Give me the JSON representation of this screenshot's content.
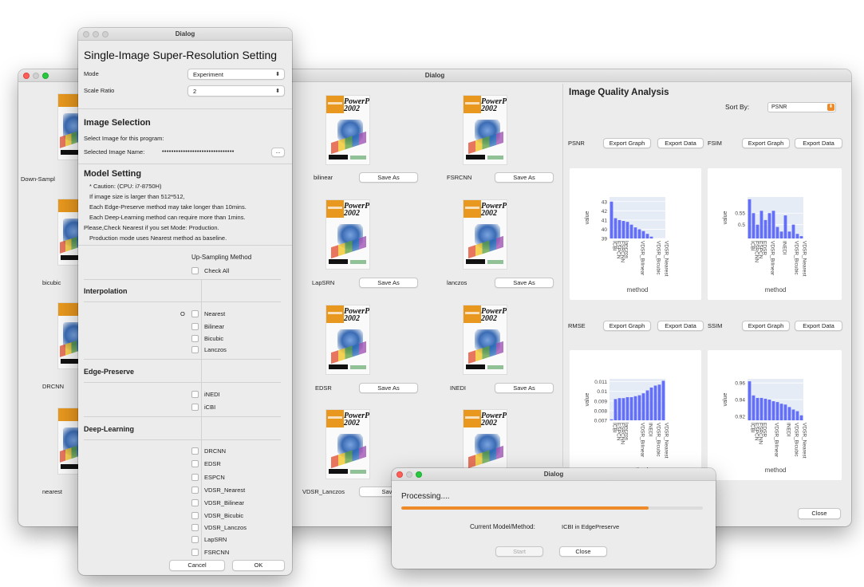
{
  "main_window": {
    "title": "Dialog",
    "left_column": [
      {
        "label": "Down-Sampl"
      },
      {
        "label": "bicubic"
      },
      {
        "label": "DRCNN"
      },
      {
        "label": "nearest"
      }
    ],
    "grid": [
      {
        "label": "bilinear",
        "button": "Save As"
      },
      {
        "label": "FSRCNN",
        "button": "Save As"
      },
      {
        "label": "LapSRN",
        "button": "Save As"
      },
      {
        "label": "lanczos",
        "button": "Save As"
      },
      {
        "label": "EDSR",
        "button": "Save As"
      },
      {
        "label": "INEDI",
        "button": "Save As"
      },
      {
        "label": "VDSR_Lanczos",
        "button": "Save"
      }
    ],
    "thumb_text": {
      "power": "PowerPoint",
      "year": "2002"
    },
    "analysis": {
      "title": "Image Quality Analysis",
      "sort_by_label": "Sort By:",
      "sort_by_value": "PSNR",
      "export_graph": "Export Graph",
      "export_data": "Export Data",
      "close": "Close",
      "bar_color": "#636efa",
      "metrics": [
        "PSNR",
        "FSIM",
        "RMSE",
        "SSIM"
      ]
    }
  },
  "chart_data": [
    {
      "type": "bar",
      "title": "PSNR",
      "xlabel": "method",
      "ylabel": "value",
      "categories": [
        "ICBI",
        "ESPCN",
        "FSRCNN",
        "lanczos",
        "EDSR",
        "bicubic",
        "LapSRN",
        "VDSR_Bilinear",
        "DRCNN",
        "INEDI",
        "bilinear",
        "VDSR_Bicubic",
        "VDSR_Lanczos",
        "VDSR_Nearest"
      ],
      "values": [
        43.0,
        41.2,
        41.0,
        40.9,
        40.8,
        40.5,
        40.2,
        40.0,
        39.8,
        39.5,
        39.2,
        39.0,
        38.6,
        38.2
      ],
      "ylim": [
        39,
        43.5
      ],
      "yticks": [
        39,
        40,
        41,
        42,
        43
      ],
      "tick_labels": [
        "ICBI",
        "ESPCN",
        "FSRCNN",
        "lanczos",
        "VDSR_Bilinear",
        "VDSR_Bicubic",
        "VDSR_Nearest"
      ]
    },
    {
      "type": "bar",
      "title": "FSIM",
      "xlabel": "method",
      "ylabel": "value",
      "categories": [
        "ICBI",
        "FSRCNN",
        "ESPCN",
        "EDSR",
        "lanczos",
        "VDSR_Bilinear",
        "bicubic",
        "DRCNN",
        "INEDI",
        "LapSRN",
        "bilinear",
        "VDSR_Bicubic",
        "VDSR_Lanczos",
        "VDSR_Nearest"
      ],
      "values": [
        0.61,
        0.55,
        0.5,
        0.56,
        0.52,
        0.55,
        0.56,
        0.49,
        0.47,
        0.54,
        0.47,
        0.5,
        0.46,
        0.45
      ],
      "ylim": [
        0.44,
        0.62
      ],
      "yticks": [
        0.5,
        0.55
      ],
      "tick_labels": [
        "ICBI",
        "FSRCNN",
        "ESPCN",
        "EDSR",
        "VDSR_Bilinear",
        "INEDI",
        "VDSR_Bicubic",
        "VDSR_Nearest"
      ]
    },
    {
      "type": "bar",
      "title": "RMSE",
      "xlabel": "method",
      "ylabel": "value",
      "categories": [
        "ICBI",
        "ESPCN",
        "FSRCNN",
        "lanczos",
        "EDSR",
        "bicubic",
        "LapSRN",
        "VDSR_Bilinear",
        "DRCNN",
        "INEDI",
        "bilinear",
        "VDSR_Bicubic",
        "VDSR_Lanczos",
        "VDSR_Nearest"
      ],
      "values": [
        0.0071,
        0.0092,
        0.0093,
        0.0093,
        0.0094,
        0.0094,
        0.0095,
        0.0096,
        0.0098,
        0.0101,
        0.0104,
        0.0106,
        0.0107,
        0.0111
      ],
      "ylim": [
        0.007,
        0.0113
      ],
      "yticks": [
        0.007,
        0.008,
        0.009,
        0.01,
        0.011
      ],
      "tick_labels": [
        "ICBI",
        "ESPCN",
        "FSRCNN",
        "lanczos",
        "VDSR_Bilinear",
        "INEDI",
        "VDSR_Bicubic",
        "VDSR_Nearest"
      ]
    },
    {
      "type": "bar",
      "title": "SSIM",
      "xlabel": "method",
      "ylabel": "value",
      "categories": [
        "ICBI",
        "ESPCN",
        "FSRCNN",
        "EDSR",
        "lanczos",
        "bicubic",
        "VDSR_Bilinear",
        "LapSRN",
        "DRCNN",
        "INEDI",
        "bilinear",
        "VDSR_Bicubic",
        "VDSR_Lanczos",
        "VDSR_Nearest"
      ],
      "values": [
        0.962,
        0.945,
        0.942,
        0.942,
        0.941,
        0.94,
        0.938,
        0.937,
        0.935,
        0.934,
        0.931,
        0.928,
        0.926,
        0.921
      ],
      "ylim": [
        0.915,
        0.965
      ],
      "yticks": [
        0.92,
        0.94,
        0.96
      ],
      "tick_labels": [
        "ICBI",
        "ESPCN",
        "FSRCNN",
        "EDSR",
        "VDSR_Bilinear",
        "INEDI",
        "VDSR_Bicubic",
        "VDSR_Nearest"
      ]
    }
  ],
  "settings_dialog": {
    "title": "Dialog",
    "heading": "Single-Image Super-Resolution Setting",
    "mode_label": "Mode",
    "mode_value": "Experiment",
    "scale_label": "Scale Ratio",
    "scale_value": "2",
    "image_selection": {
      "heading": "Image Selection",
      "line1": "Select Image for this program:",
      "name_label": "Selected Image Name:",
      "name_value": "•••••••••••••••••••••••••••••••",
      "browse": "..."
    },
    "model_setting": {
      "heading": "Model Setting",
      "lines": [
        "* Caution: (CPU: i7-8750H)",
        "If image size is larger than 512*512,",
        "Each Edge-Preserve method may take longer than 10mins.",
        "Each Deep-Learning method can require more than 1mins.",
        "Please,Check Nearest if you set Mode: Production.",
        "Production mode uses Nearest method as baseline."
      ]
    },
    "upsampling_header": "Up-Sampling Method",
    "check_all": "Check All",
    "interpolation": {
      "heading": "Interpolation",
      "marker": "O",
      "items": [
        "Nearest",
        "Bilinear",
        "Bicubic",
        "Lanczos"
      ]
    },
    "edge_preserve": {
      "heading": "Edge-Preserve",
      "items": [
        "iNEDI",
        "iCBI"
      ]
    },
    "deep_learning": {
      "heading": "Deep-Learning",
      "items": [
        "DRCNN",
        "EDSR",
        "ESPCN",
        "VDSR_Nearest",
        "VDSR_Bilinear",
        "VDSR_Bicubic",
        "VDSR_Lanczos",
        "LapSRN",
        "FSRCNN"
      ]
    },
    "cancel": "Cancel",
    "ok": "OK"
  },
  "progress_dialog": {
    "title": "Dialog",
    "processing": "Processing....",
    "progress": 0.82,
    "current_label": "Current Model/Method:",
    "current_value": "ICBI in EdgePreserve",
    "start": "Start",
    "close": "Close"
  }
}
